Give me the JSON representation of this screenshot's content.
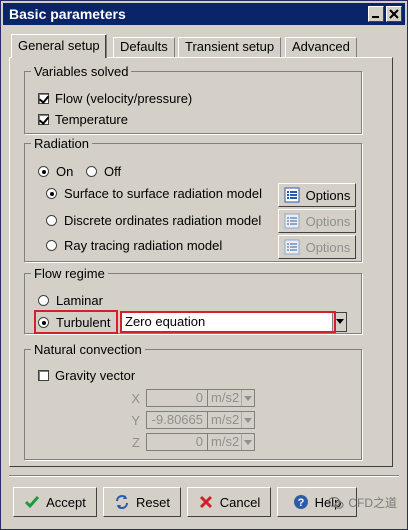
{
  "window": {
    "title": "Basic parameters"
  },
  "tabs": [
    {
      "label": "General setup",
      "active": true
    },
    {
      "label": "Defaults",
      "active": false
    },
    {
      "label": "Transient setup",
      "active": false
    },
    {
      "label": "Advanced",
      "active": false
    }
  ],
  "variables": {
    "legend": "Variables solved",
    "flow": {
      "label": "Flow (velocity/pressure)",
      "checked": true
    },
    "temperature": {
      "label": "Temperature",
      "checked": true
    }
  },
  "radiation": {
    "legend": "Radiation",
    "on_label": "On",
    "off_label": "Off",
    "selected": "On",
    "models": [
      {
        "label": "Surface to surface radiation model",
        "selected": true,
        "options_label": "Options",
        "options_enabled": true
      },
      {
        "label": "Discrete ordinates radiation model",
        "selected": false,
        "options_label": "Options",
        "options_enabled": false
      },
      {
        "label": "Ray tracing radiation model",
        "selected": false,
        "options_label": "Options",
        "options_enabled": false
      }
    ]
  },
  "flow_regime": {
    "legend": "Flow regime",
    "laminar_label": "Laminar",
    "turbulent_label": "Turbulent",
    "selected": "Turbulent",
    "turbulence_model": "Zero equation"
  },
  "natural_convection": {
    "legend": "Natural convection",
    "gravity_label": "Gravity vector",
    "gravity_checked": false,
    "x": {
      "label": "X",
      "value": "0",
      "unit": "m/s2"
    },
    "y": {
      "label": "Y",
      "value": "-9.80665",
      "unit": "m/s2"
    },
    "z": {
      "label": "Z",
      "value": "0",
      "unit": "m/s2"
    }
  },
  "buttons": {
    "accept": "Accept",
    "reset": "Reset",
    "cancel": "Cancel",
    "help": "Help"
  },
  "watermark": "CFD之道",
  "colors": {
    "titlebar": "#0a246a",
    "highlight": "#d3212b",
    "face": "#d4d0c8"
  }
}
